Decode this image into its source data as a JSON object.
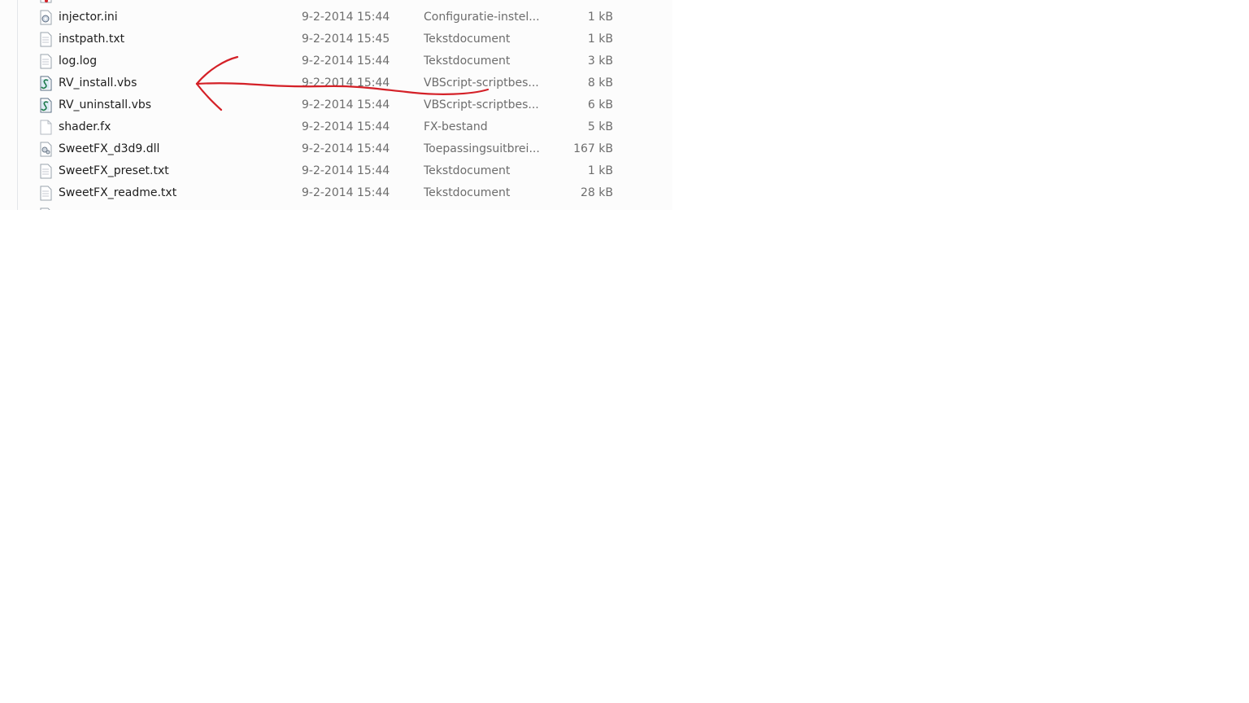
{
  "files": [
    {
      "name": "injector.ini",
      "date": "9-2-2014 15:44",
      "type": "Configuratie-instel...",
      "size": "1 kB",
      "icon": "settings-file-icon"
    },
    {
      "name": "instpath.txt",
      "date": "9-2-2014 15:45",
      "type": "Tekstdocument",
      "size": "1 kB",
      "icon": "text-file-icon"
    },
    {
      "name": "log.log",
      "date": "9-2-2014 15:44",
      "type": "Tekstdocument",
      "size": "3 kB",
      "icon": "text-file-icon"
    },
    {
      "name": "RV_install.vbs",
      "date": "9-2-2014 15:44",
      "type": "VBScript-scriptbes...",
      "size": "8 kB",
      "icon": "vbscript-file-icon"
    },
    {
      "name": "RV_uninstall.vbs",
      "date": "9-2-2014 15:44",
      "type": "VBScript-scriptbes...",
      "size": "6 kB",
      "icon": "vbscript-file-icon"
    },
    {
      "name": "shader.fx",
      "date": "9-2-2014 15:44",
      "type": "FX-bestand",
      "size": "5 kB",
      "icon": "blank-file-icon"
    },
    {
      "name": "SweetFX_d3d9.dll",
      "date": "9-2-2014 15:44",
      "type": "Toepassingsuitbrei...",
      "size": "167 kB",
      "icon": "dll-file-icon"
    },
    {
      "name": "SweetFX_preset.txt",
      "date": "9-2-2014 15:44",
      "type": "Tekstdocument",
      "size": "1 kB",
      "icon": "text-file-icon"
    },
    {
      "name": "SweetFX_readme.txt",
      "date": "9-2-2014 15:44",
      "type": "Tekstdocument",
      "size": "28 kB",
      "icon": "text-file-icon"
    }
  ],
  "colors": {
    "annotation": "#d42027",
    "name_text": "#1e1e1e",
    "detail_text": "#6d6d6d",
    "pane_background": "#fcfcfc"
  }
}
